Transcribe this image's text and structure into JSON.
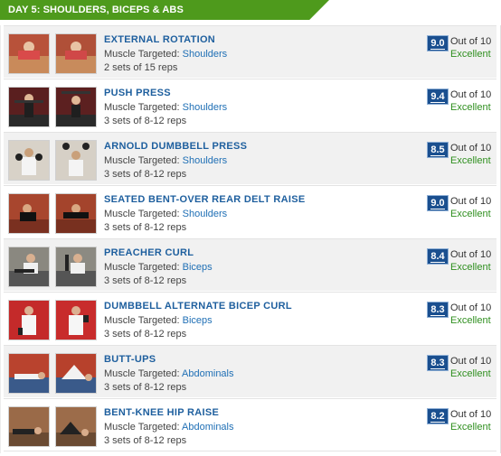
{
  "header": {
    "title": "DAY 5: SHOULDERS, BICEPS & ABS",
    "color": "#4e9a1c"
  },
  "labels": {
    "muscle_prefix": "Muscle Targeted: "
  },
  "exercises": [
    {
      "name": "EXTERNAL ROTATION",
      "muscle": "Shoulders",
      "sets": "2 sets of 15 reps",
      "score": "9.0",
      "out_of": "Out of 10",
      "rating": "Excellent"
    },
    {
      "name": "PUSH PRESS",
      "muscle": "Shoulders",
      "sets": "3 sets of 8-12 reps",
      "score": "9.4",
      "out_of": "Out of 10",
      "rating": "Excellent"
    },
    {
      "name": "ARNOLD DUMBBELL PRESS",
      "muscle": "Shoulders",
      "sets": "3 sets of 8-12 reps",
      "score": "8.5",
      "out_of": "Out of 10",
      "rating": "Excellent"
    },
    {
      "name": "SEATED BENT-OVER REAR DELT RAISE",
      "muscle": "Shoulders",
      "sets": "3 sets of 8-12 reps",
      "score": "9.0",
      "out_of": "Out of 10",
      "rating": "Excellent"
    },
    {
      "name": "PREACHER CURL",
      "muscle": "Biceps",
      "sets": "3 sets of 8-12 reps",
      "score": "8.4",
      "out_of": "Out of 10",
      "rating": "Excellent"
    },
    {
      "name": "DUMBBELL ALTERNATE BICEP CURL",
      "muscle": "Biceps",
      "sets": "3 sets of 8-12 reps",
      "score": "8.3",
      "out_of": "Out of 10",
      "rating": "Excellent"
    },
    {
      "name": "BUTT-UPS",
      "muscle": "Abdominals",
      "sets": "3 sets of 8-12 reps",
      "score": "8.3",
      "out_of": "Out of 10",
      "rating": "Excellent"
    },
    {
      "name": "BENT-KNEE HIP RAISE",
      "muscle": "Abdominals",
      "sets": "3 sets of 8-12 reps",
      "score": "8.2",
      "out_of": "Out of 10",
      "rating": "Excellent"
    }
  ]
}
